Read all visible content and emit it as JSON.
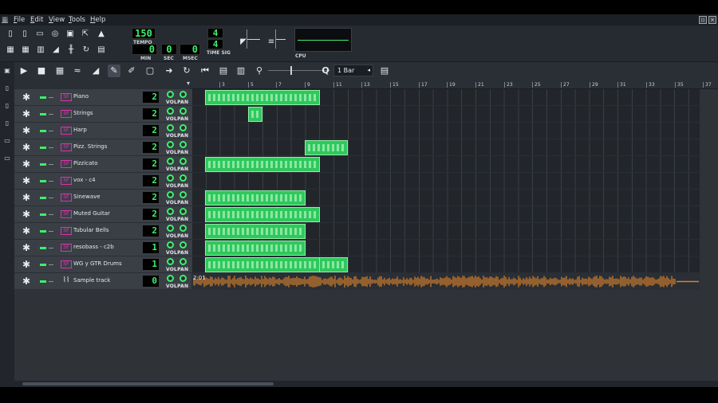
{
  "menu": {
    "items": [
      "File",
      "Edit",
      "View",
      "Tools",
      "Help"
    ]
  },
  "toolbar": {
    "tempo_value": "150",
    "tempo_label": "TEMPO",
    "time_min": "0",
    "time_sec": "0",
    "time_msec": "0",
    "min_label": "MIN",
    "sec_label": "SEC",
    "msec_label": "MSEC",
    "timesig_num": "4",
    "timesig_den": "4",
    "timesig_label": "TIME SIG",
    "cpu_label": "CPU"
  },
  "song_editor": {
    "zoom_value": "1 Bar",
    "ruler_ticks": [
      "3",
      "5",
      "7",
      "9",
      "11",
      "13",
      "15",
      "17",
      "19",
      "21",
      "23",
      "25",
      "27",
      "29",
      "31",
      "33",
      "35",
      "37"
    ],
    "vol_label": "VOL",
    "pan_label": "PAN",
    "tracks": [
      {
        "name": "Piano",
        "number": "2"
      },
      {
        "name": "Strings",
        "number": "2"
      },
      {
        "name": "Harp",
        "number": "2"
      },
      {
        "name": "Pizz. Strings",
        "number": "2"
      },
      {
        "name": "Pizzicato",
        "number": "2"
      },
      {
        "name": "vox - c4",
        "number": "2"
      },
      {
        "name": "Sinewave",
        "number": "2"
      },
      {
        "name": "Muted Guitar",
        "number": "2"
      },
      {
        "name": "Tubular Bells",
        "number": "2"
      },
      {
        "name": "resobass - c2b",
        "number": "1"
      },
      {
        "name": "WG y GTR Drums",
        "number": "1"
      },
      {
        "name": "Sample track",
        "number": "0"
      }
    ],
    "sample_clip_label": "2:01"
  },
  "colors": {
    "clip_green": "#2fc85c",
    "lcd_green": "#3df06a",
    "instrument_magenta": "#e030b0",
    "waveform_orange": "#d9822b"
  }
}
